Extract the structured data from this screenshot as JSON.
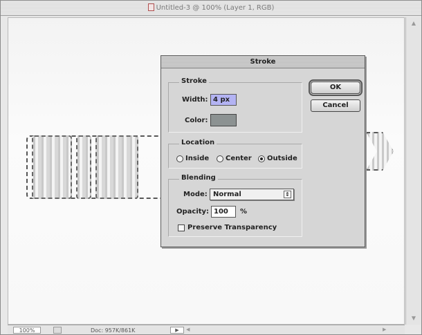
{
  "window": {
    "title": "Untitled-3 @ 100% (Layer 1, RGB)"
  },
  "artwork": {
    "text": "KID"
  },
  "dialog": {
    "title": "Stroke",
    "stroke_group": {
      "label": "Stroke",
      "width_label": "Width:",
      "width_value": "4 px",
      "color_label": "Color:",
      "color_value": "#8c9292"
    },
    "location_group": {
      "label": "Location",
      "options": [
        "Inside",
        "Center",
        "Outside"
      ],
      "selected": "Outside"
    },
    "blending_group": {
      "label": "Blending",
      "mode_label": "Mode:",
      "mode_value": "Normal",
      "opacity_label": "Opacity:",
      "opacity_value": "100",
      "opacity_unit": "%",
      "preserve_label": "Preserve Transparency",
      "preserve_checked": false
    },
    "buttons": {
      "ok": "OK",
      "cancel": "Cancel"
    }
  },
  "statusbar": {
    "zoom": "100%",
    "doc_size": "Doc: 957K/861K"
  }
}
